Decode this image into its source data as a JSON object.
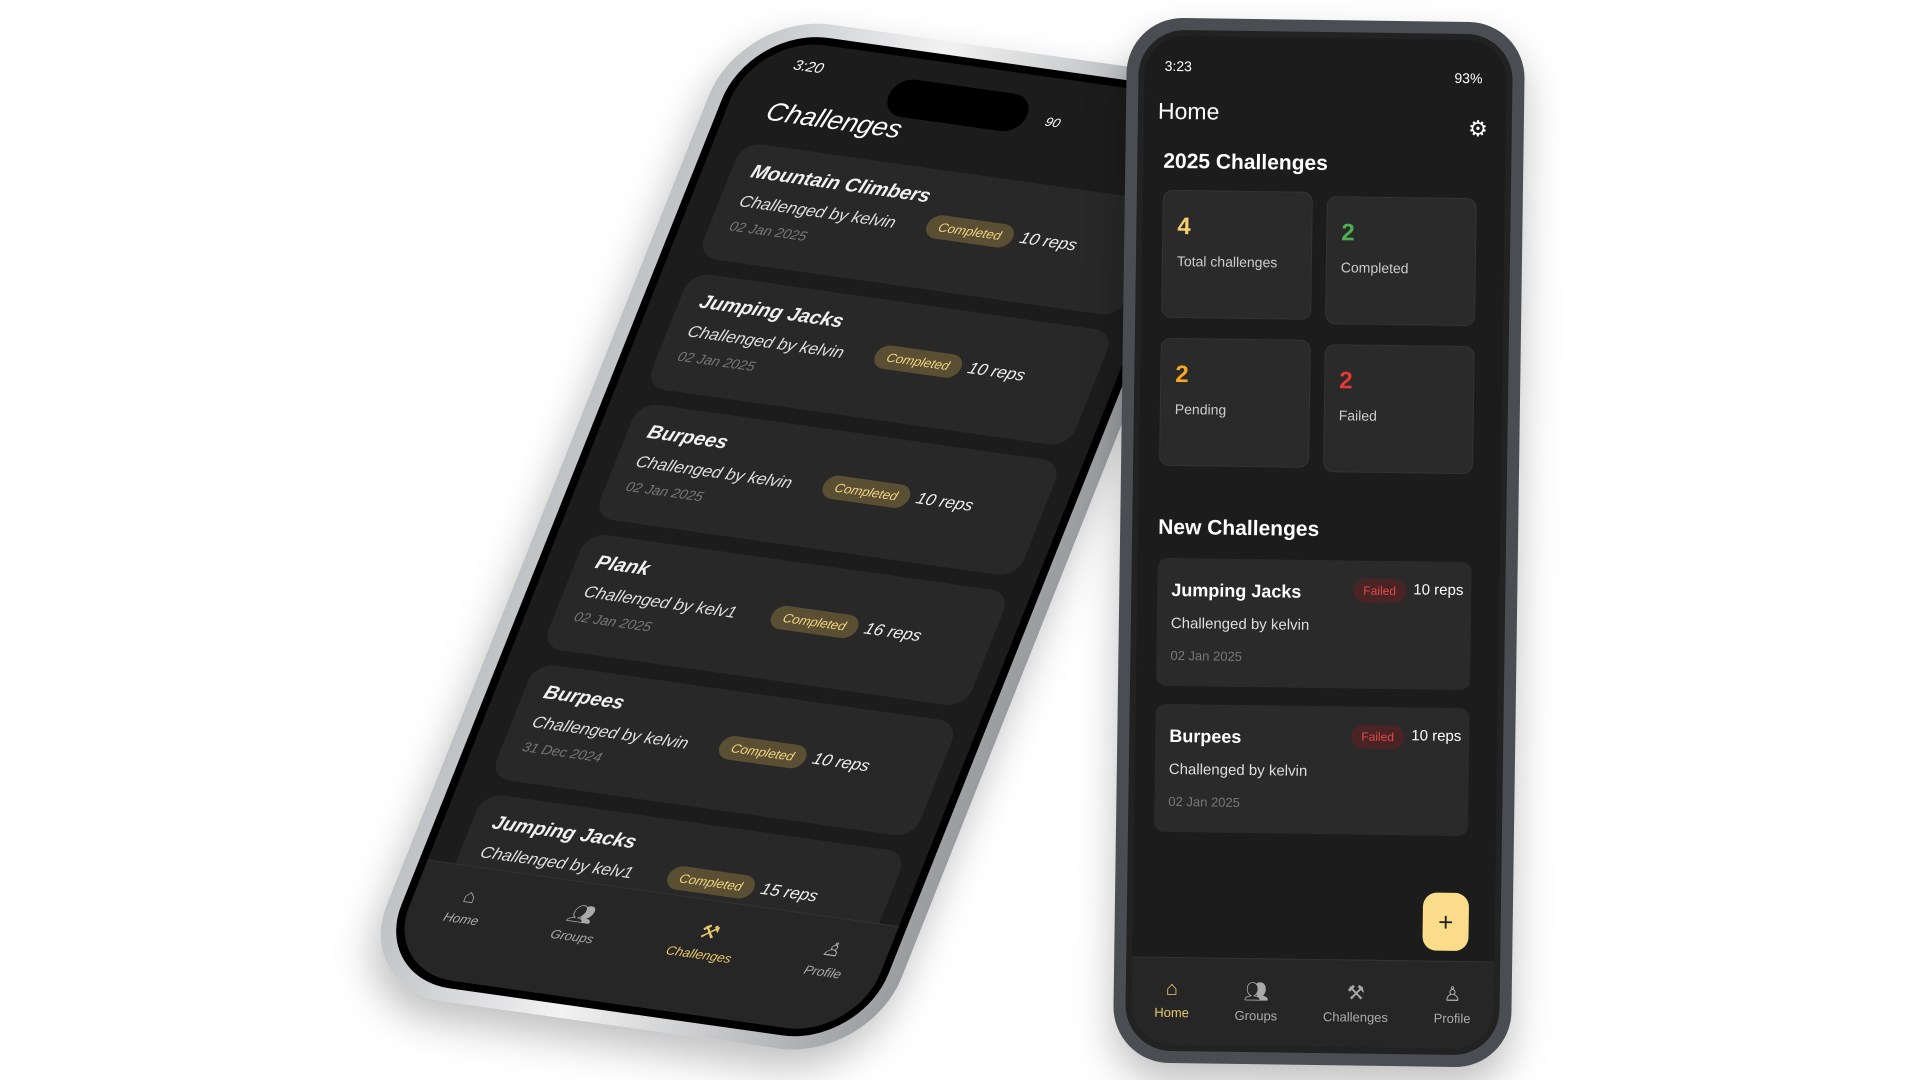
{
  "left_phone": {
    "status_time": "3:20",
    "status_right": "90",
    "title": "Challenges",
    "cards": [
      {
        "name": "Mountain Climbers",
        "by": "Challenged by kelvin",
        "date": "02 Jan 2025",
        "status": "Completed",
        "reps": "10 reps"
      },
      {
        "name": "Jumping Jacks",
        "by": "Challenged by kelvin",
        "date": "02 Jan 2025",
        "status": "Completed",
        "reps": "10 reps"
      },
      {
        "name": "Burpees",
        "by": "Challenged by kelvin",
        "date": "02 Jan 2025",
        "status": "Completed",
        "reps": "10 reps"
      },
      {
        "name": "Plank",
        "by": "Challenged by kelv1",
        "date": "02 Jan 2025",
        "status": "Completed",
        "reps": "16 reps"
      },
      {
        "name": "Burpees",
        "by": "Challenged by kelvin",
        "date": "31 Dec 2024",
        "status": "Completed",
        "reps": "10 reps"
      },
      {
        "name": "Jumping Jacks",
        "by": "Challenged by kelv1",
        "date": "",
        "status": "Completed",
        "reps": "15 reps"
      }
    ],
    "nav": [
      {
        "label": "Home",
        "icon": "home-icon"
      },
      {
        "label": "Groups",
        "icon": "groups-icon"
      },
      {
        "label": "Challenges",
        "icon": "dumbbell-icon",
        "active": true
      },
      {
        "label": "Profile",
        "icon": "profile-icon"
      }
    ]
  },
  "right_phone": {
    "status_time": "3:23",
    "battery": "93%",
    "title": "Home",
    "stats_title": "2025 Challenges",
    "stats": [
      {
        "value": "4",
        "label": "Total challenges",
        "color": "#f5cf6b"
      },
      {
        "value": "2",
        "label": "Completed",
        "color": "#4caf50"
      },
      {
        "value": "2",
        "label": "Pending",
        "color": "#f5a623"
      },
      {
        "value": "2",
        "label": "Failed",
        "color": "#e53935"
      }
    ],
    "new_title": "New Challenges",
    "cards": [
      {
        "name": "Jumping Jacks",
        "by": "Challenged by kelvin",
        "date": "02 Jan 2025",
        "status": "Failed",
        "reps": "10 reps"
      },
      {
        "name": "Burpees",
        "by": "Challenged by kelvin",
        "date": "02 Jan 2025",
        "status": "Failed",
        "reps": "10 reps"
      }
    ],
    "fab": "+",
    "nav": [
      {
        "label": "Home",
        "icon": "home-icon",
        "active": true
      },
      {
        "label": "Groups",
        "icon": "groups-icon"
      },
      {
        "label": "Challenges",
        "icon": "dumbbell-icon"
      },
      {
        "label": "Profile",
        "icon": "profile-icon"
      }
    ]
  },
  "colors": {
    "accent": "#f5cf6b",
    "failed": "#e53935",
    "completed_badge": "#5a4e33"
  }
}
